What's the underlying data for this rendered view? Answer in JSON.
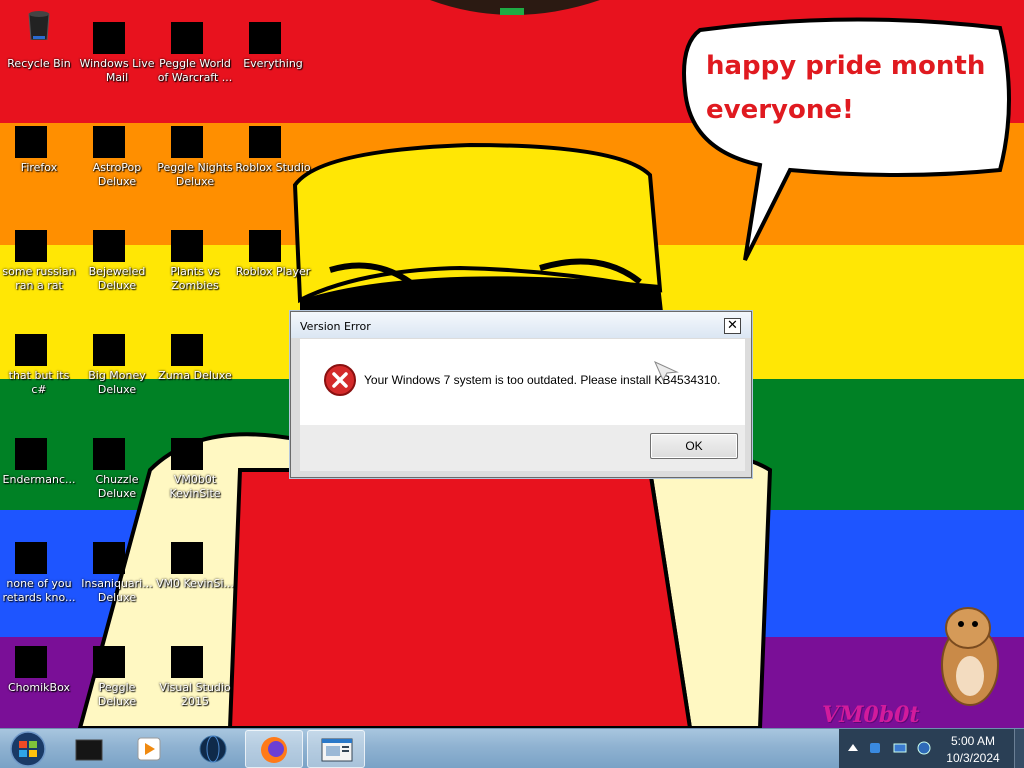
{
  "wallpaper": {
    "stripe_colors": [
      "#e8121e",
      "#ff8f00",
      "#ffe705",
      "#008125",
      "#1e55ff",
      "#7a0f97"
    ],
    "speech_bubble_text": "happy pride month everyone!",
    "watermark": "VM0b0t"
  },
  "desktop_icons": [
    {
      "label": "Recycle Bin",
      "icon": "recycle-bin-icon"
    },
    {
      "label": "Windows Live Mail",
      "icon": "mail-icon"
    },
    {
      "label": "Peggle World of Warcraft ...",
      "icon": "peggle-wow-icon"
    },
    {
      "label": "Everything",
      "icon": "search-icon"
    },
    {
      "label": "Firefox",
      "icon": "firefox-icon"
    },
    {
      "label": "AstroPop Deluxe",
      "icon": "astropop-icon"
    },
    {
      "label": "Peggle Nights Deluxe",
      "icon": "peggle-nights-icon"
    },
    {
      "label": "Roblox Studio",
      "icon": "roblox-studio-icon"
    },
    {
      "label": "some russian ran a rat",
      "icon": "file-icon"
    },
    {
      "label": "Bejeweled Deluxe",
      "icon": "bejeweled-icon"
    },
    {
      "label": "Plants vs Zombies",
      "icon": "plants-vs-zombies-icon"
    },
    {
      "label": "Roblox Player",
      "icon": "roblox-player-icon"
    },
    {
      "label": "that but its c#",
      "icon": "shortcut-icon"
    },
    {
      "label": "Big Money Deluxe",
      "icon": "big-money-icon"
    },
    {
      "label": "Zuma Deluxe",
      "icon": "zuma-icon"
    },
    {
      "label": "Endermanc...",
      "icon": "terminal-icon"
    },
    {
      "label": "Chuzzle Deluxe",
      "icon": "chuzzle-icon"
    },
    {
      "label": "VM0b0t KevinSite",
      "icon": "vm0b0t-icon"
    },
    {
      "label": "none of you retards kno...",
      "icon": "ball-icon"
    },
    {
      "label": "Insaniquari... Deluxe",
      "icon": "insaniquarium-icon"
    },
    {
      "label": "VM0 KevinSi...",
      "icon": "vm0-icon"
    },
    {
      "label": "ChomikBox",
      "icon": "chomikbox-icon"
    },
    {
      "label": "Peggle Deluxe",
      "icon": "peggle-icon"
    },
    {
      "label": "Visual Studio 2015",
      "icon": "visual-studio-icon"
    }
  ],
  "dialog": {
    "title": "Version Error",
    "close_label": "✕",
    "message": "Your Windows 7 system is too outdated. Please install KB4534310.",
    "ok_label": "OK",
    "icon": "error-icon"
  },
  "taskbar": {
    "start_icon": "windows-start-icon",
    "items": [
      {
        "icon": "dark-app-icon",
        "active": false
      },
      {
        "icon": "media-player-icon",
        "active": false
      },
      {
        "icon": "globe-icon",
        "active": false
      },
      {
        "icon": "firefox-icon",
        "active": true
      },
      {
        "icon": "window-icon",
        "active": true
      }
    ],
    "tray_icons": [
      "show-hidden-icons",
      "network-icon",
      "monitor-icon",
      "volume-icon"
    ],
    "clock_time": "5:00 AM",
    "clock_date": "10/3/2024"
  }
}
